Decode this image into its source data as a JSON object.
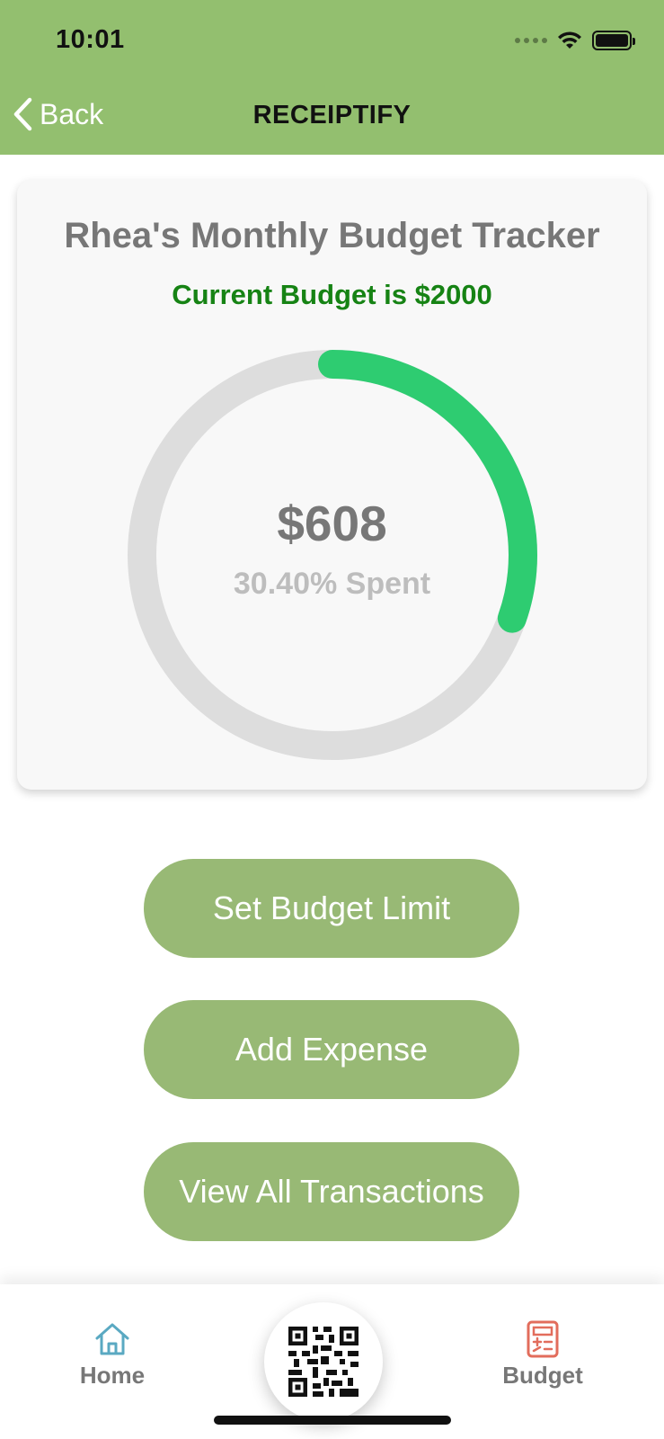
{
  "status_bar": {
    "time": "10:01"
  },
  "nav": {
    "back_label": "Back",
    "title": "RECEIPTIFY"
  },
  "budget_card": {
    "title": "Rhea's Monthly Budget Tracker",
    "subtitle": "Current Budget is $2000",
    "spent_amount": "$608",
    "spent_percent_label": "30.40% Spent",
    "progress_fraction": 0.304,
    "colors": {
      "progress": "#2ecc71",
      "track": "#dddddd",
      "subtitle": "#168314"
    }
  },
  "actions": {
    "set_budget_limit": "Set Budget Limit",
    "add_expense": "Add Expense",
    "view_all_transactions": "View All Transactions"
  },
  "tabbar": {
    "home_label": "Home",
    "budget_label": "Budget",
    "center_icon": "qr-code-icon"
  },
  "theme": {
    "header": "#93bf6f",
    "button": "#98b975"
  }
}
